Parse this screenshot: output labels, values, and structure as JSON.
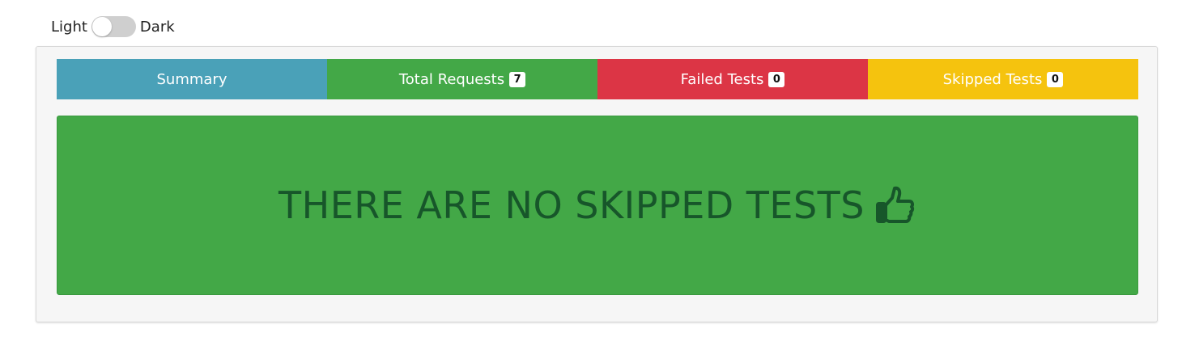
{
  "theme_toggle": {
    "light_label": "Light",
    "dark_label": "Dark",
    "state": "light"
  },
  "tabs": [
    {
      "label": "Summary",
      "badge": null,
      "color": "#4aa1b8"
    },
    {
      "label": "Total Requests",
      "badge": "7",
      "color": "#43a847"
    },
    {
      "label": "Failed Tests",
      "badge": "0",
      "color": "#dc3545"
    },
    {
      "label": "Skipped Tests",
      "badge": "0",
      "color": "#f5c30e"
    }
  ],
  "panel": {
    "message": "THERE ARE NO SKIPPED TESTS",
    "icon": "thumbs-up-icon",
    "background": "#43a847",
    "text_color": "#17562a"
  }
}
